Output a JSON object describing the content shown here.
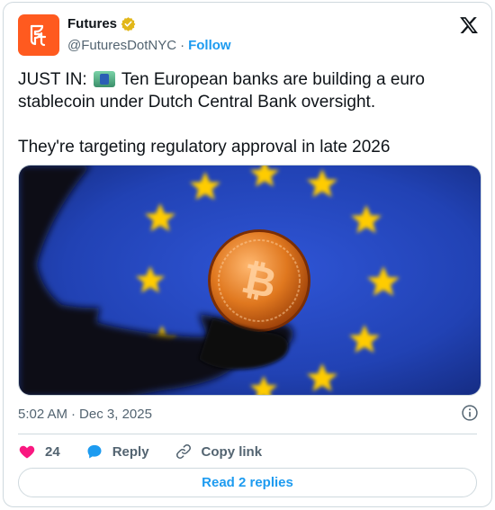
{
  "account": {
    "display_name": "Futures",
    "handle": "@FuturesDotNYC",
    "separator": "·",
    "follow_label": "Follow",
    "avatar_text": "Ft"
  },
  "tweet": {
    "line1_prefix": "JUST IN: ",
    "line1_rest": " Ten European banks are building a euro stablecoin under Dutch Central Bank oversight.",
    "line2": "They're targeting regulatory approval in late 2026"
  },
  "meta": {
    "time": "5:02 AM",
    "separator": "·",
    "date": "Dec 3, 2025"
  },
  "actions": {
    "like_count": "24",
    "reply_label": "Reply",
    "copy_label": "Copy link"
  },
  "replies_button": "Read 2 replies",
  "colors": {
    "brand": "#ff5a1f",
    "link": "#1d9bf0",
    "like": "#f91880",
    "verified_gold": "#e2b719",
    "eu_blue": "#1f3fa8",
    "star_yellow": "#ffcc00"
  }
}
